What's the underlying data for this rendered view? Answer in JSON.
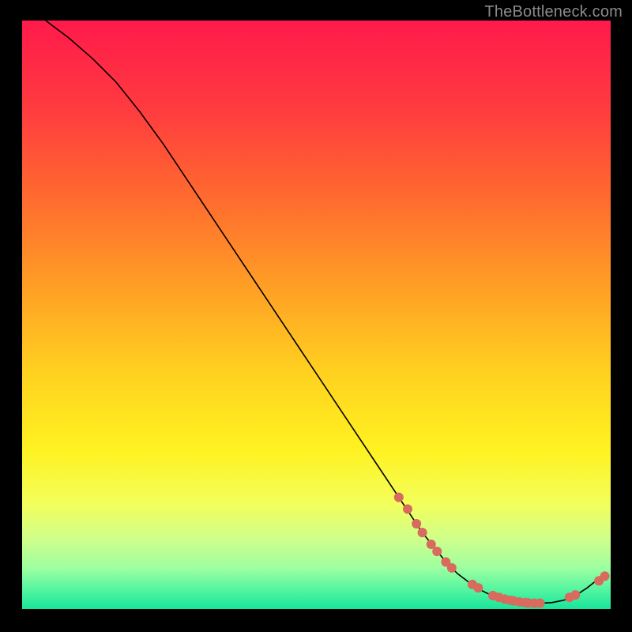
{
  "watermark": "TheBottleneck.com",
  "chart_data": {
    "type": "line",
    "title": "",
    "xlabel": "",
    "ylabel": "",
    "xlim": [
      0,
      100
    ],
    "ylim": [
      0,
      100
    ],
    "grid": false,
    "legend": false,
    "background_gradient": [
      {
        "stop": 0.0,
        "color": "#ff1a4b"
      },
      {
        "stop": 0.15,
        "color": "#ff3b3f"
      },
      {
        "stop": 0.3,
        "color": "#ff6a2f"
      },
      {
        "stop": 0.45,
        "color": "#ff9e25"
      },
      {
        "stop": 0.6,
        "color": "#ffd21f"
      },
      {
        "stop": 0.73,
        "color": "#fff221"
      },
      {
        "stop": 0.82,
        "color": "#f3ff5a"
      },
      {
        "stop": 0.88,
        "color": "#d0ff8a"
      },
      {
        "stop": 0.93,
        "color": "#9effa0"
      },
      {
        "stop": 0.97,
        "color": "#4ef4a0"
      },
      {
        "stop": 1.0,
        "color": "#19e59a"
      }
    ],
    "series": [
      {
        "name": "bottleneck-curve",
        "color": "#000000",
        "x": [
          4,
          8,
          12,
          16,
          20,
          24,
          28,
          32,
          36,
          40,
          44,
          48,
          52,
          56,
          60,
          64,
          66,
          68,
          70,
          72,
          74,
          76,
          78,
          80,
          82,
          84,
          86,
          88,
          90,
          92,
          94,
          96,
          98
        ],
        "y": [
          100,
          97,
          93.5,
          89.5,
          84.5,
          79,
          73,
          67,
          61,
          55,
          49,
          43,
          37,
          31,
          25,
          19,
          16,
          13,
          10.5,
          8,
          6,
          4.5,
          3.2,
          2.2,
          1.5,
          1.1,
          1.0,
          1.0,
          1.1,
          1.5,
          2.3,
          3.6,
          5.2
        ]
      }
    ],
    "points": [
      {
        "name": "markers",
        "color": "#d86a5e",
        "radius_px": 6,
        "items": [
          {
            "x": 64.0,
            "y": 19.0
          },
          {
            "x": 65.5,
            "y": 17.0
          },
          {
            "x": 67.0,
            "y": 14.5
          },
          {
            "x": 68.0,
            "y": 13.0
          },
          {
            "x": 69.5,
            "y": 11.0
          },
          {
            "x": 70.5,
            "y": 9.8
          },
          {
            "x": 72.0,
            "y": 8.0
          },
          {
            "x": 73.0,
            "y": 7.0
          },
          {
            "x": 76.5,
            "y": 4.2
          },
          {
            "x": 77.5,
            "y": 3.6
          },
          {
            "x": 80.0,
            "y": 2.3
          },
          {
            "x": 81.0,
            "y": 2.0
          },
          {
            "x": 82.0,
            "y": 1.7
          },
          {
            "x": 83.0,
            "y": 1.5
          },
          {
            "x": 83.5,
            "y": 1.4
          },
          {
            "x": 84.5,
            "y": 1.2
          },
          {
            "x": 85.5,
            "y": 1.1
          },
          {
            "x": 86.0,
            "y": 1.05
          },
          {
            "x": 87.0,
            "y": 1.0
          },
          {
            "x": 88.0,
            "y": 1.0
          },
          {
            "x": 93.0,
            "y": 2.0
          },
          {
            "x": 94.0,
            "y": 2.4
          },
          {
            "x": 98.0,
            "y": 4.8
          },
          {
            "x": 99.0,
            "y": 5.6
          }
        ]
      }
    ]
  }
}
